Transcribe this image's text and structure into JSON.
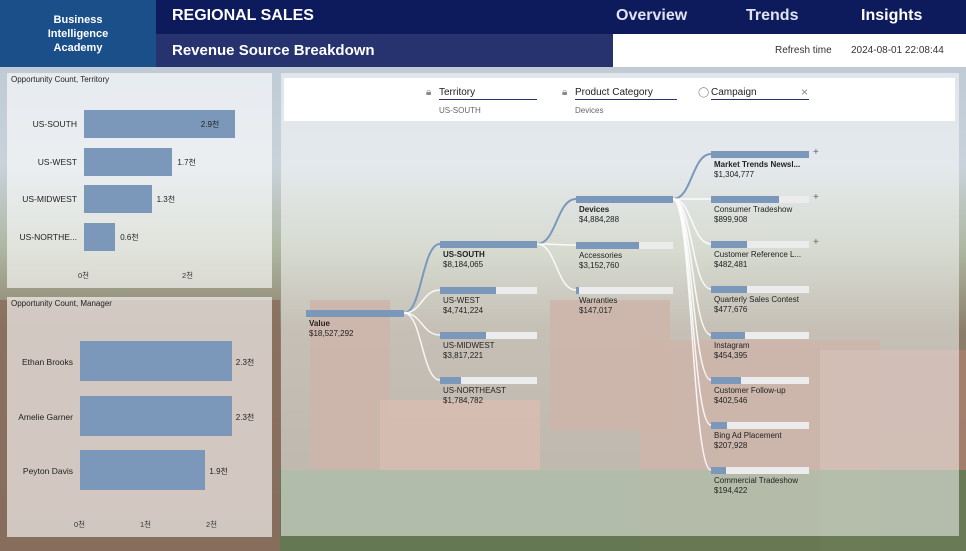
{
  "header": {
    "logo": "Business Intelligence Academy",
    "title": "REGIONAL SALES",
    "nav": [
      "Overview",
      "Trends",
      "Insights"
    ],
    "subtitle": "Revenue Source Breakdown",
    "refresh_label": "Refresh time",
    "refresh_value": "2024-08-01 22:08:44"
  },
  "territory_chart": {
    "title": "Opportunity Count, Territory",
    "categories": [
      "US-SOUTH",
      "US-WEST",
      "US-MIDWEST",
      "US-NORTHE..."
    ],
    "values": [
      2.9,
      1.7,
      1.3,
      0.6
    ],
    "value_labels": [
      "2.9천",
      "1.7천",
      "1.3천",
      "0.6천"
    ],
    "ticks": [
      "0천",
      "2천"
    ]
  },
  "manager_chart": {
    "title": "Opportunity Count, Manager",
    "categories": [
      "Ethan Brooks",
      "Amelie Garner",
      "Peyton Davis"
    ],
    "values": [
      2.3,
      2.3,
      1.9
    ],
    "value_labels": [
      "2.3천",
      "2.3천",
      "1.9천"
    ],
    "ticks": [
      "0천",
      "1천",
      "2천"
    ]
  },
  "filters": [
    {
      "label": "Territory",
      "value": "US-SOUTH",
      "icon": "lock-icon"
    },
    {
      "label": "Product Category",
      "value": "Devices",
      "icon": "lock-icon"
    },
    {
      "label": "Campaign",
      "value": "",
      "icon": "lightbulb-icon"
    }
  ],
  "filter_close": "×",
  "tree": {
    "root": {
      "label": "Value",
      "value": "$18,527,292"
    },
    "territory": [
      {
        "label": "US-SOUTH",
        "value": "$8,184,065",
        "frac": 1.0
      },
      {
        "label": "US-WEST",
        "value": "$4,741,224",
        "frac": 0.58
      },
      {
        "label": "US-MIDWEST",
        "value": "$3,817,221",
        "frac": 0.47
      },
      {
        "label": "US-NORTHEAST",
        "value": "$1,784,782",
        "frac": 0.22
      }
    ],
    "category": [
      {
        "label": "Devices",
        "value": "$4,884,288",
        "frac": 1.0
      },
      {
        "label": "Accessories",
        "value": "$3,152,760",
        "frac": 0.65
      },
      {
        "label": "Warranties",
        "value": "$147,017",
        "frac": 0.03
      }
    ],
    "campaign": [
      {
        "label": "Market Trends Newsl...",
        "value": "$1,304,777",
        "frac": 1.0
      },
      {
        "label": "Consumer Tradeshow",
        "value": "$899,908",
        "frac": 0.69
      },
      {
        "label": "Customer Reference L...",
        "value": "$482,481",
        "frac": 0.37
      },
      {
        "label": "Quarterly Sales Contest",
        "value": "$477,676",
        "frac": 0.37
      },
      {
        "label": "Instagram",
        "value": "$454,395",
        "frac": 0.35
      },
      {
        "label": "Customer Follow-up",
        "value": "$402,546",
        "frac": 0.31
      },
      {
        "label": "Bing Ad Placement",
        "value": "$207,928",
        "frac": 0.16
      },
      {
        "label": "Commercial Tradeshow",
        "value": "$194,422",
        "frac": 0.15
      }
    ],
    "expand_symbol": "+"
  }
}
